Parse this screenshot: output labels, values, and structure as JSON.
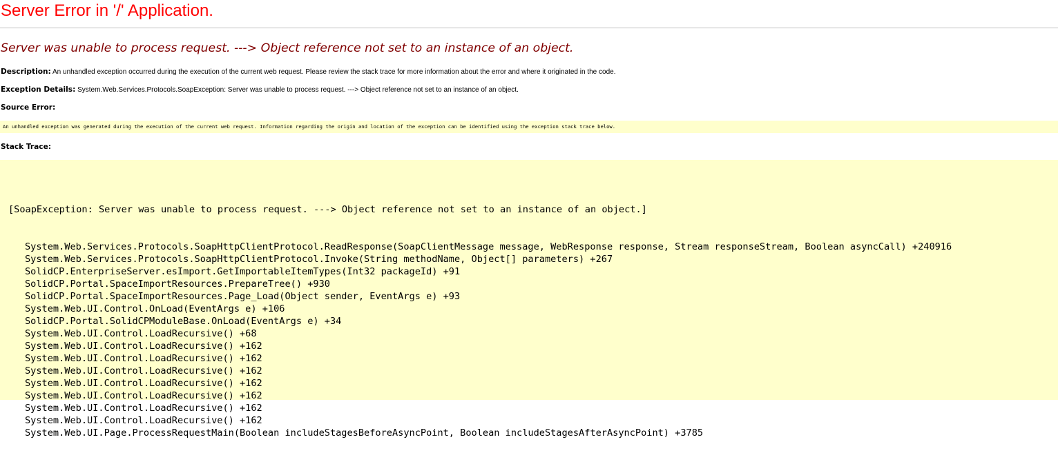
{
  "page": {
    "title": "Server Error in '/' Application.",
    "headline": "Server was unable to process request. ---> Object reference not set to an instance of an object."
  },
  "description": {
    "label": "Description:",
    "text": " An unhandled exception occurred during the execution of the current web request. Please review the stack trace for more information about the error and where it originated in the code."
  },
  "exception_details": {
    "label": "Exception Details:",
    "text": " System.Web.Services.Protocols.SoapException: Server was unable to process request. ---> Object reference not set to an instance of an object."
  },
  "source_error": {
    "heading": "Source Error:",
    "text": "An unhandled exception was generated during the execution of the current web request. Information regarding the origin and location of the exception can be identified using the exception stack trace below."
  },
  "stack_trace": {
    "heading": "Stack Trace:",
    "header_line": "[SoapException: Server was unable to process request. ---> Object reference not set to an instance of an object.]",
    "frames": [
      "System.Web.Services.Protocols.SoapHttpClientProtocol.ReadResponse(SoapClientMessage message, WebResponse response, Stream responseStream, Boolean asyncCall) +240916",
      "System.Web.Services.Protocols.SoapHttpClientProtocol.Invoke(String methodName, Object[] parameters) +267",
      "SolidCP.EnterpriseServer.esImport.GetImportableItemTypes(Int32 packageId) +91",
      "SolidCP.Portal.SpaceImportResources.PrepareTree() +930",
      "SolidCP.Portal.SpaceImportResources.Page_Load(Object sender, EventArgs e) +93",
      "System.Web.UI.Control.OnLoad(EventArgs e) +106",
      "SolidCP.Portal.SolidCPModuleBase.OnLoad(EventArgs e) +34",
      "System.Web.UI.Control.LoadRecursive() +68",
      "System.Web.UI.Control.LoadRecursive() +162",
      "System.Web.UI.Control.LoadRecursive() +162",
      "System.Web.UI.Control.LoadRecursive() +162",
      "System.Web.UI.Control.LoadRecursive() +162",
      "System.Web.UI.Control.LoadRecursive() +162",
      "System.Web.UI.Control.LoadRecursive() +162",
      "System.Web.UI.Control.LoadRecursive() +162",
      "System.Web.UI.Page.ProcessRequestMain(Boolean includeStagesBeforeAsyncPoint, Boolean includeStagesAfterAsyncPoint) +3785"
    ]
  },
  "colors": {
    "title": "#ff0000",
    "headline": "#800000",
    "code_background": "#ffffcc",
    "rule": "#c0c0c0"
  }
}
